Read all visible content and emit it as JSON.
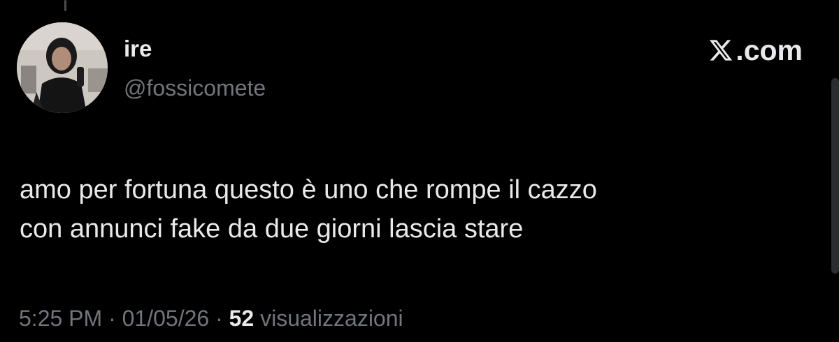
{
  "author": {
    "display_name": "ire",
    "handle": "@fossicomete"
  },
  "brand": {
    "label": ".com",
    "icon": "x-logo-icon"
  },
  "tweet": {
    "text_lines": [
      "amo per fortuna questo è uno che rompe il cazzo",
      "con annunci fake da due giorni lascia stare"
    ]
  },
  "meta": {
    "time": "5:25 PM",
    "separator": "·",
    "date": "01/05/26",
    "views_count": "52",
    "views_label": "visualizzazioni"
  },
  "colors": {
    "background": "#000000",
    "primary_text": "#e7e9ea",
    "secondary_text": "#71767b"
  }
}
